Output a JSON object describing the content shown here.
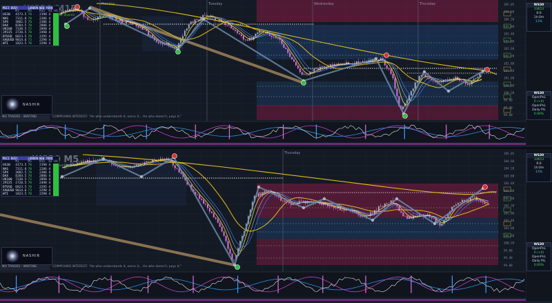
{
  "panes": [
    {
      "symbol": "WS30 M15",
      "subtitle": "Confluence Bars Goc Sharmi",
      "days": [
        "Monday",
        "Tuesday",
        "Wednesday",
        "Thursday"
      ],
      "compound_text": "COMPOUND INTEREST: \"He who understands it, earns it... He who doesn't, pays it.\"",
      "no_trades": "NO TRADES - WAITING",
      "logo": "NASHIR",
      "right_box": {
        "title": "WS30",
        "line1": "33653",
        "line2": "6:0",
        "line3": "1h:0m",
        "line4": "13%"
      },
      "right_box2": {
        "title": "WS30",
        "l1": "OpenPnL",
        "l2": "0 (+0)",
        "l3": "OpenPnL",
        "l4": "0.00%",
        "l5": "Daily P/L",
        "l6": "0.00%"
      },
      "price_labels": [
        "105.05",
        "104.60",
        "104.20",
        "103.80",
        "103.40",
        "103.00",
        "102.60",
        "102.20",
        "101.80",
        "101.40",
        "101.00",
        "100.60",
        "100.20",
        "99.80",
        "99.40",
        "99.00"
      ]
    },
    {
      "symbol": "WS30 M5",
      "subtitle": "Confluence Bars Goc Sharmi",
      "days": [
        "Thursday"
      ],
      "compound_text": "COMPOUND INTEREST: \"He who understands it, earns it... He who doesn't, pays it.\"",
      "no_trades": "NO TRADES - WAITING",
      "logo": "NASHIR",
      "right_box": {
        "title": "WS30",
        "line1": "33653",
        "line2": "6:0",
        "line3": "1h:0m",
        "line4": "13%"
      },
      "right_box2": {
        "title": "WS30",
        "l1": "OpenPnL",
        "l2": "0 (+0)",
        "l3": "OpenPnL",
        "l4": "0.00%",
        "l5": "Daily P/L",
        "l6": "0.00%"
      },
      "price_labels": [
        "105.05",
        "104.60",
        "104.20",
        "103.80",
        "103.40",
        "103.00",
        "102.60",
        "102.20",
        "101.80",
        "101.40",
        "101.00",
        "100.60",
        "100.20",
        "99.80",
        "99.40",
        "99.00"
      ]
    }
  ],
  "info_table": {
    "headers": [
      "M1",
      "M5",
      "M15",
      "H1",
      "H4"
    ],
    "rows": [
      [
        "US30",
        "4173.5",
        "70",
        "2198",
        "4"
      ],
      [
        "NAS",
        "7311.8",
        "70",
        "2286",
        "4"
      ],
      [
        "SPX",
        "3882.5",
        "70",
        "2386",
        "4"
      ],
      [
        "DAX",
        "8284.5",
        "70",
        "2886",
        "4"
      ],
      [
        "UK100",
        "7338.5",
        "72",
        "2898",
        "4"
      ],
      [
        "JP225",
        "2720.5",
        "70",
        "2498",
        "4"
      ],
      [
        "BTUSD",
        "6823.5",
        "70",
        "2295",
        "4"
      ],
      [
        "XAUUSD",
        "9014.6",
        "73",
        "2298",
        "4"
      ],
      [
        "WTI",
        "1823.5",
        "70",
        "2298",
        "4"
      ]
    ]
  },
  "header_tags": [
    "MSCI BUSY",
    "LONDON",
    "NEW YORK"
  ],
  "colors": {
    "bull": "#9aa4b8",
    "bear": "#d070d0",
    "ma_fast": "#f0d020",
    "ma_slow": "#2a6ad8",
    "trend": "#b09060",
    "zig": "#6888a8",
    "buy": "#30c040",
    "sell": "#e03030"
  }
}
